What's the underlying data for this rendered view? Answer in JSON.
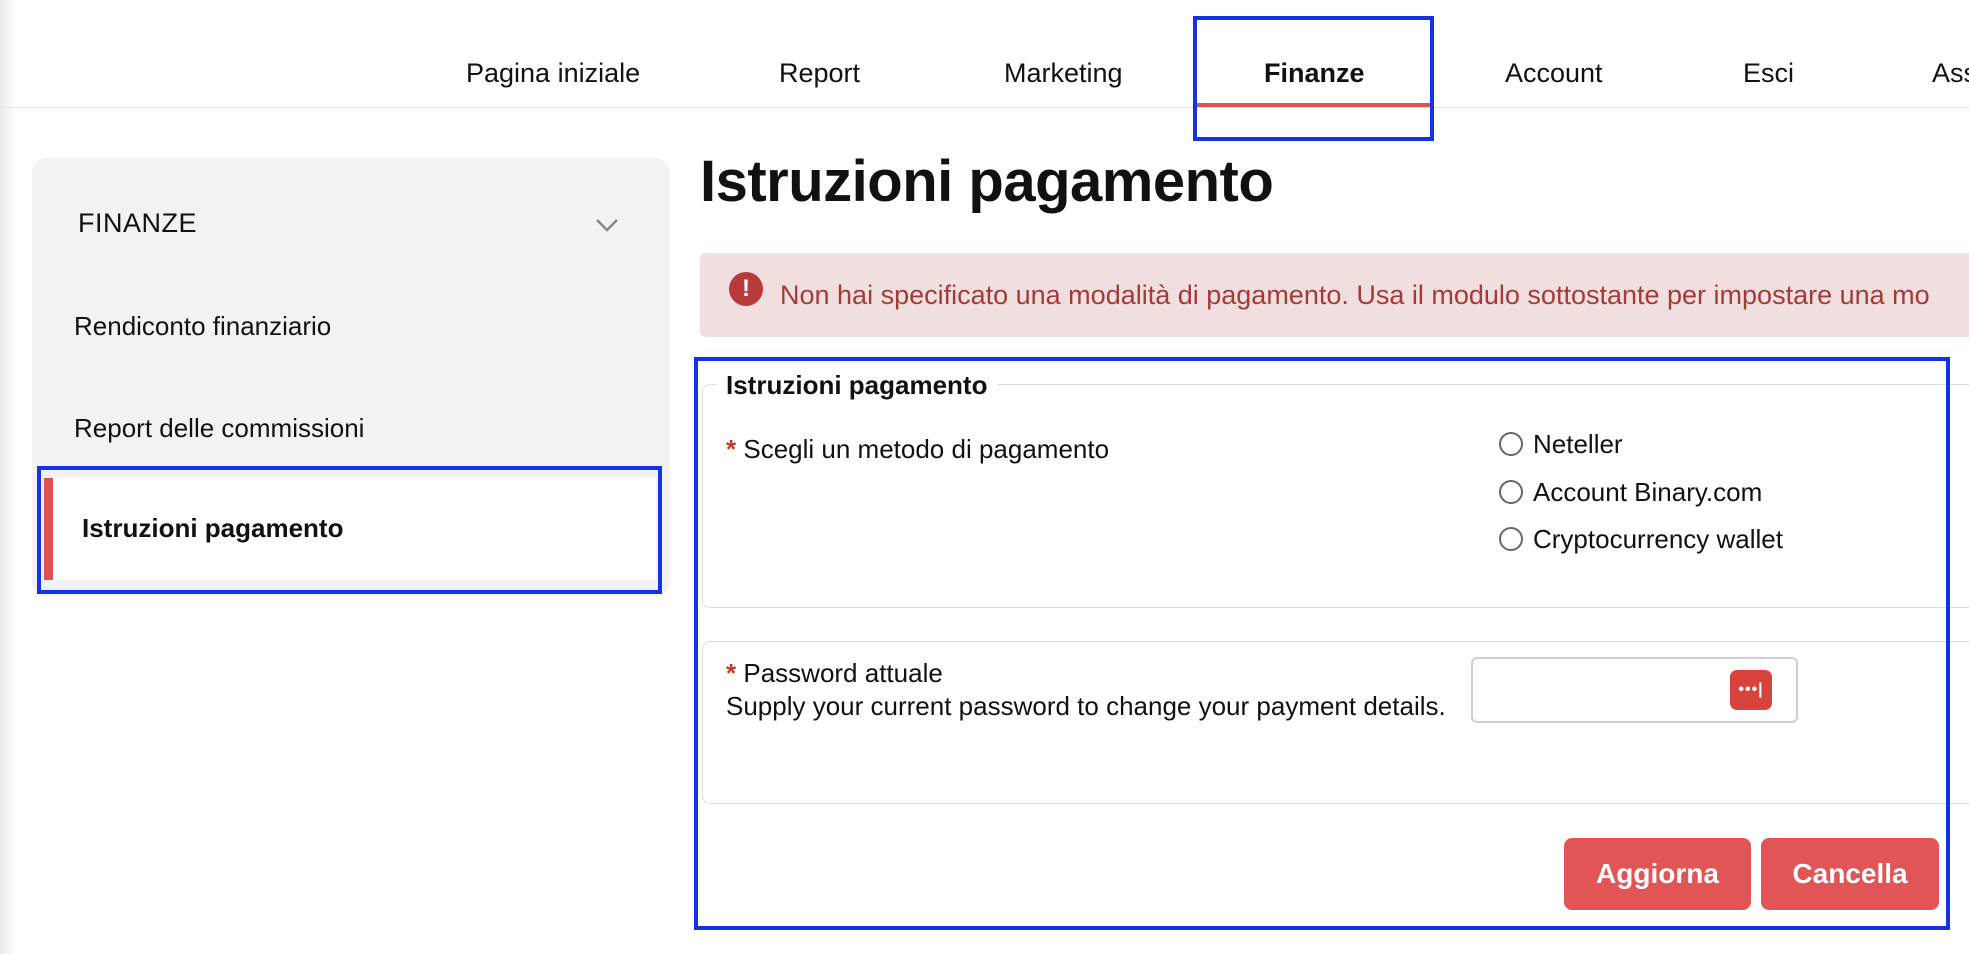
{
  "topnav": {
    "items": [
      {
        "label": "Pagina iniziale"
      },
      {
        "label": "Report"
      },
      {
        "label": "Marketing"
      },
      {
        "label": "Finanze"
      },
      {
        "label": "Account"
      },
      {
        "label": "Esci"
      },
      {
        "label": "Ass"
      }
    ],
    "active": "Finanze"
  },
  "sidebar": {
    "header": "FINANZE",
    "items": [
      {
        "label": "Rendiconto finanziario"
      },
      {
        "label": "Report delle commissioni"
      },
      {
        "label": "Istruzioni pagamento"
      }
    ],
    "active": "Istruzioni pagamento"
  },
  "main": {
    "title": "Istruzioni pagamento",
    "alert": {
      "icon": "exclamation-circle-icon",
      "text": "Non hai specificato una modalità di pagamento. Usa il modulo sottostante per impostare una mo"
    },
    "form": {
      "legend": "Istruzioni pagamento",
      "required_marker": "*",
      "payment_method_label": "Scegli un metodo di pagamento",
      "payment_options": [
        "Neteller",
        "Account Binary.com",
        "Cryptocurrency wallet"
      ],
      "password_label": "Password attuale",
      "password_help": "Supply your current password to change your payment details.",
      "password_value": "",
      "password_manager_icon": "password-manager-icon",
      "password_manager_glyph": "•••|",
      "update_label": "Aggiorna",
      "cancel_label": "Cancella"
    }
  },
  "colors": {
    "accent": "#e05252",
    "highlight": "#1533e6",
    "alert_bg": "#f1dede",
    "alert_text": "#a33b3b"
  }
}
